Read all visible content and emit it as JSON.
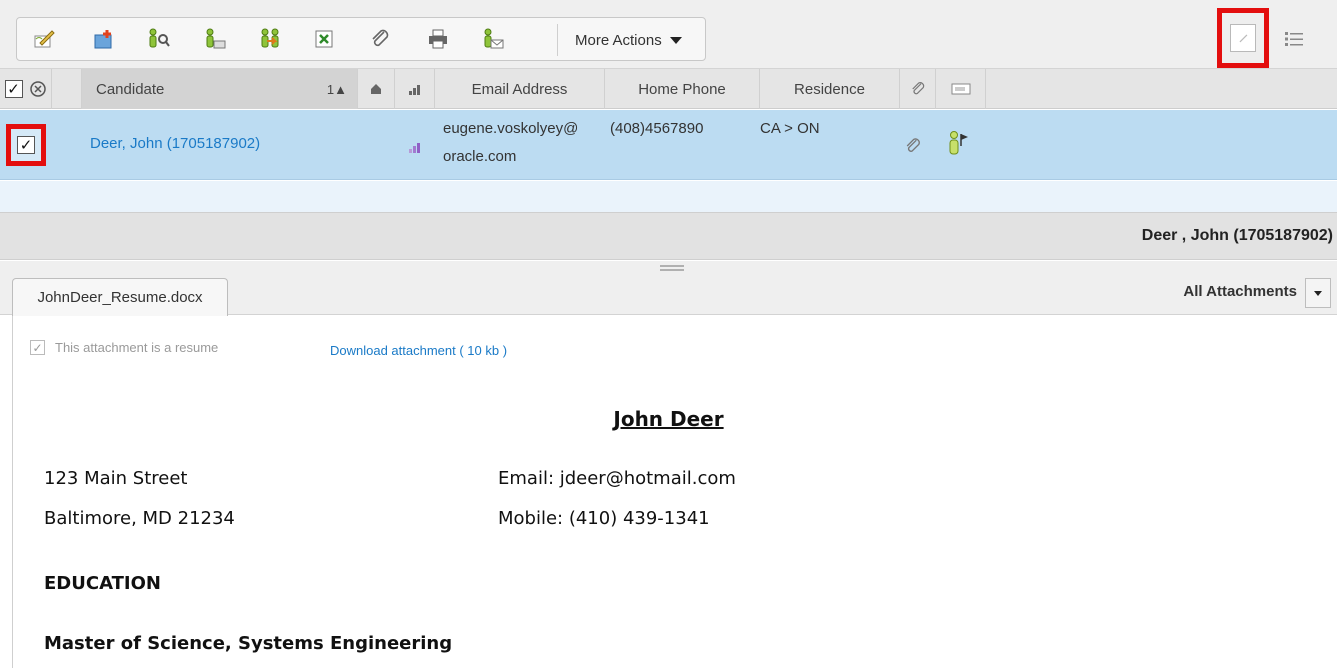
{
  "toolbar": {
    "icons": [
      "edit-icon",
      "new-icon",
      "search-person-icon",
      "person-card-icon",
      "transfer-person-icon",
      "excel-export-icon",
      "attach-icon",
      "print-icon",
      "email-person-icon"
    ],
    "more_actions_label": "More Actions",
    "view_modes": [
      "detail-view-icon",
      "list-view-icon"
    ]
  },
  "grid": {
    "columns": {
      "candidate": "Candidate",
      "sort_indicator": "1▲",
      "email": "Email Address",
      "phone": "Home Phone",
      "residence": "Residence"
    },
    "row": {
      "checked_mark": "✓",
      "candidate": "Deer, John (1705187902)",
      "email_line1": "eugene.voskolyey@",
      "email_line2": "oracle.com",
      "phone": "(408)4567890",
      "residence": "CA > ON"
    }
  },
  "summary": {
    "name": "Deer , John (1705187902)"
  },
  "attachments": {
    "tab_label": "JohnDeer_Resume.docx",
    "filter_label": "All Attachments",
    "is_resume_label": "This attachment is a resume",
    "download_label": "Download attachment ( 10 kb )"
  },
  "document": {
    "name": "John Deer",
    "street": "123 Main Street",
    "city": "Baltimore, MD 21234",
    "email": "Email: jdeer@hotmail.com",
    "mobile": "Mobile: (410) 439-1341",
    "section_education": "EDUCATION",
    "degree": "Master of Science, Systems Engineering"
  },
  "colors": {
    "selected_row": "#bcdcf2",
    "link": "#1a7ac7",
    "highlight_border": "#e30e0e"
  }
}
